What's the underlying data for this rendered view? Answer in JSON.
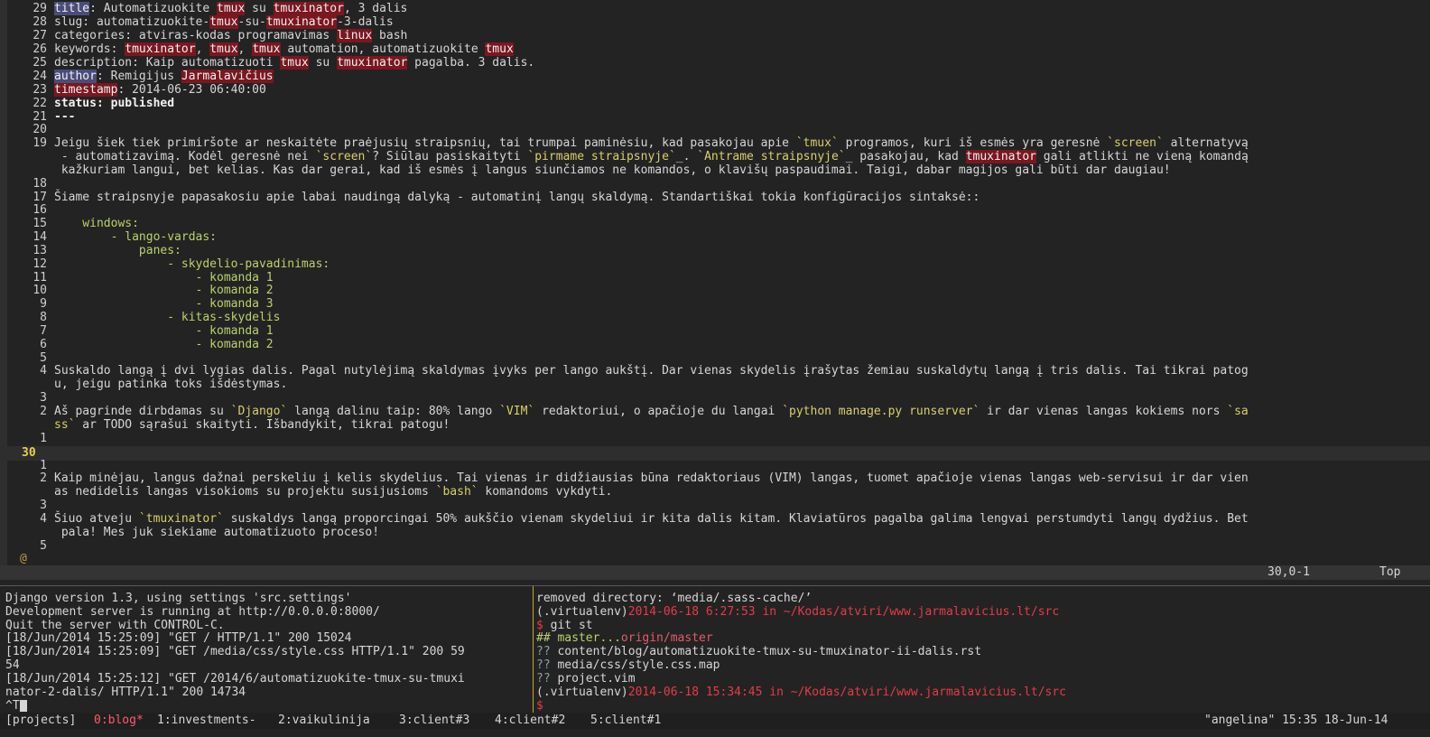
{
  "editor": {
    "lines": [
      {
        "n": "29",
        "html": "title"
      },
      {
        "n": "28"
      },
      {
        "n": "27"
      },
      {
        "n": "26"
      },
      {
        "n": "25"
      },
      {
        "n": "24"
      },
      {
        "n": "23"
      },
      {
        "n": "22"
      },
      {
        "n": "21"
      },
      {
        "n": "20"
      },
      {
        "n": "19"
      },
      {
        "n": "18"
      },
      {
        "n": "17"
      },
      {
        "n": "16"
      },
      {
        "n": "15"
      },
      {
        "n": "14"
      },
      {
        "n": "13"
      },
      {
        "n": "12"
      },
      {
        "n": "11"
      },
      {
        "n": "10"
      },
      {
        "n": "9"
      },
      {
        "n": "8"
      },
      {
        "n": "7"
      },
      {
        "n": "6"
      },
      {
        "n": "5"
      },
      {
        "n": "4"
      },
      {
        "n": "3"
      },
      {
        "n": "2"
      },
      {
        "n": "1"
      },
      {
        "n": "30"
      },
      {
        "n": "1"
      },
      {
        "n": "2"
      },
      {
        "n": "3"
      },
      {
        "n": "4"
      },
      {
        "n": "5"
      }
    ],
    "text": {
      "l29_a": "title",
      "l29_b": ": Automatizuokite ",
      "l29_c": "tmux",
      "l29_d": " su ",
      "l29_e": "tmuxinator",
      "l29_f": ", 3 dalis",
      "l28_a": "slug: automatizuokite-",
      "l28_b": "tmux",
      "l28_c": "-su-",
      "l28_d": "tmuxinator",
      "l28_e": "-3-dalis",
      "l27_a": "categories: atviras-kodas programavimas ",
      "l27_b": "linux",
      "l27_c": " bash",
      "l26_a": "keywords: ",
      "l26_b": "tmuxinator",
      "l26_c": ", ",
      "l26_d": "tmux",
      "l26_e": ", ",
      "l26_f": "tmux",
      "l26_g": " automation, automatizuokite ",
      "l26_h": "tmux",
      "l25_a": "description: Kaip automatizuoti ",
      "l25_b": "tmux",
      "l25_c": " su ",
      "l25_d": "tmuxinator",
      "l25_e": " pagalba. 3 dalis.",
      "l24_a": "author",
      "l24_b": ": Remigijus ",
      "l24_c": "Jarmalavičius",
      "l23_a": "timestamp",
      "l23_b": ": 2014-06-23 06:40:00",
      "l22": "status: published",
      "l21": "---",
      "l19_a": "Jeigu šiek tiek primiršote ar neskaitėte praėjusių straipsnių, tai trumpai paminėsiu, kad pasakojau apie ",
      "l19_b": "`tmux`",
      "l19_c": " programos, kuri iš esmės yra geresnė ",
      "l19_d": "`screen`",
      "l19_e": " alternatyvą",
      "l19w2_a": " - automatizavimą. Kodėl geresnė nei ",
      "l19w2_b": "`screen`",
      "l19w2_c": "? Siūlau pasiskaityti ",
      "l19w2_d": "`pirmame straipsnyje`",
      "l19w2_e": "_. ",
      "l19w2_f": "`Antrame straipsnyje`",
      "l19w2_g": "_ pasakojau, kad ",
      "l19w2_h": "tmuxinator",
      "l19w2_i": " gali atlikti ne vieną komandą",
      "l19w3": " kažkuriam langui, bet kelias. Kas dar gerai, kad iš esmės į langus siunčiamos ne komandos, o klavišų paspaudimai. Taigi, dabar magijos gali būti dar daugiau!",
      "l17": "Šiame straipsnyje papasakosiu apie labai naudingą dalyką - automatinį langų skaldymą. Standartiškai tokia konfigūracijos sintaksė::",
      "l15": "    windows:",
      "l14": "        - lango-vardas:",
      "l13": "            panes:",
      "l12": "                - skydelio-pavadinimas:",
      "l11": "                    - komanda 1",
      "l10": "                    - komanda 2",
      "l9": "                    - komanda 3",
      "l8": "                - kitas-skydelis",
      "l7": "                    - komanda 1",
      "l6": "                    - komanda 2",
      "l4": "Suskaldo langą į dvi lygias dalis. Pagal nutylėjimą skaldymas įvyks per lango aukštį. Dar vienas skydelis įrašytas žemiau suskaldytų langą į tris dalis. Tai tikrai patog",
      "l4w2": "u, jeigu patinka toks išdėstymas.",
      "l2_a": "Aš pagrinde dirbdamas su ",
      "l2_b": "`Django`",
      "l2_c": " langą dalinu taip: 80% lango ",
      "l2_d": "`VIM`",
      "l2_e": " redaktoriui, o apačioje du langai ",
      "l2_f": "`python manage.py runserver`",
      "l2_g": " ir dar vienas langas kokiems nors ",
      "l2_h": "`sa",
      "l2w2_a": "ss`",
      "l2w2_b": " ar TODO sąrašui skaityti. Išbandykit, tikrai patogu!",
      "r2": "Kaip minėjau, langus dažnai perskeliu į kelis skydelius. Tai vienas ir didžiausias būna redaktoriaus (VIM) langas, tuomet apačioje vienas langas web-servisui ir dar vien",
      "r2w2_a": "as nedidelis langas visokioms su projektu susijusioms ",
      "r2w2_b": "`bash`",
      "r2w2_c": " komandoms vykdyti.",
      "r4_a": "Šiuo atveju ",
      "r4_b": "`tmuxinator`",
      "r4_c": " suskaldys langą proporcingai 50% aukščio vienam skydeliui ir kita dalis kitam. Klaviatūros pagalba galima lengvai perstumdyti langų dydžius. Bet",
      "r4w2": " pala! Mes juk siekiame automatizuoto proceso!",
      "at": "@"
    },
    "status_position": "30,0-1",
    "status_scroll": "Top"
  },
  "left_pane": {
    "lines": [
      "Django version 1.3, using settings 'src.settings'",
      "Development server is running at http://0.0.0.0:8000/",
      "Quit the server with CONTROL-C.",
      "[18/Jun/2014 15:25:09] \"GET / HTTP/1.1\" 200 15024",
      "[18/Jun/2014 15:25:09] \"GET /media/css/style.css HTTP/1.1\" 200 59",
      "54",
      "[18/Jun/2014 15:25:12] \"GET /2014/6/automatizuokite-tmux-su-tmuxi",
      "nator-2-dalis/ HTTP/1.1\" 200 14734",
      "^T"
    ]
  },
  "right_pane": {
    "l1": "removed directory: ‘media/.sass-cache/’",
    "venv": "(.virtualenv)",
    "ts1": "2014-06-18 6:27:53 in ~/Kodas/atviri/www.jarmalavicius.lt/src",
    "prompt": "$",
    "cmd": " git st",
    "branch_a": "## master...",
    "branch_b": "origin/master",
    "q1": "??",
    "f1": " content/blog/automatizuokite-tmux-su-tmuxinator-ii-dalis.rst",
    "q2": "??",
    "f2": " media/css/style.css.map",
    "q3": "??",
    "f3": " project.vim",
    "ts2": "2014-06-18 15:34:45 in ~/Kodas/atviri/www.jarmalavicius.lt/src"
  },
  "tmux": {
    "session": "[projects]",
    "win0": "0:blog*",
    "win1": "1:investments-",
    "win2": "2:vaikulinija",
    "win3": "3:client#3",
    "win4": "4:client#2",
    "win5": "5:client#1",
    "host": "\"angelina\" 15:35 18-Jun-14"
  },
  "colors": {
    "background": "#232323",
    "highlight_red": "#7a1720",
    "highlight_blue": "#4a4d7a",
    "green": "#bcd16a",
    "yellow": "#d9cf6a",
    "prompt_red": "#e05c6a"
  }
}
